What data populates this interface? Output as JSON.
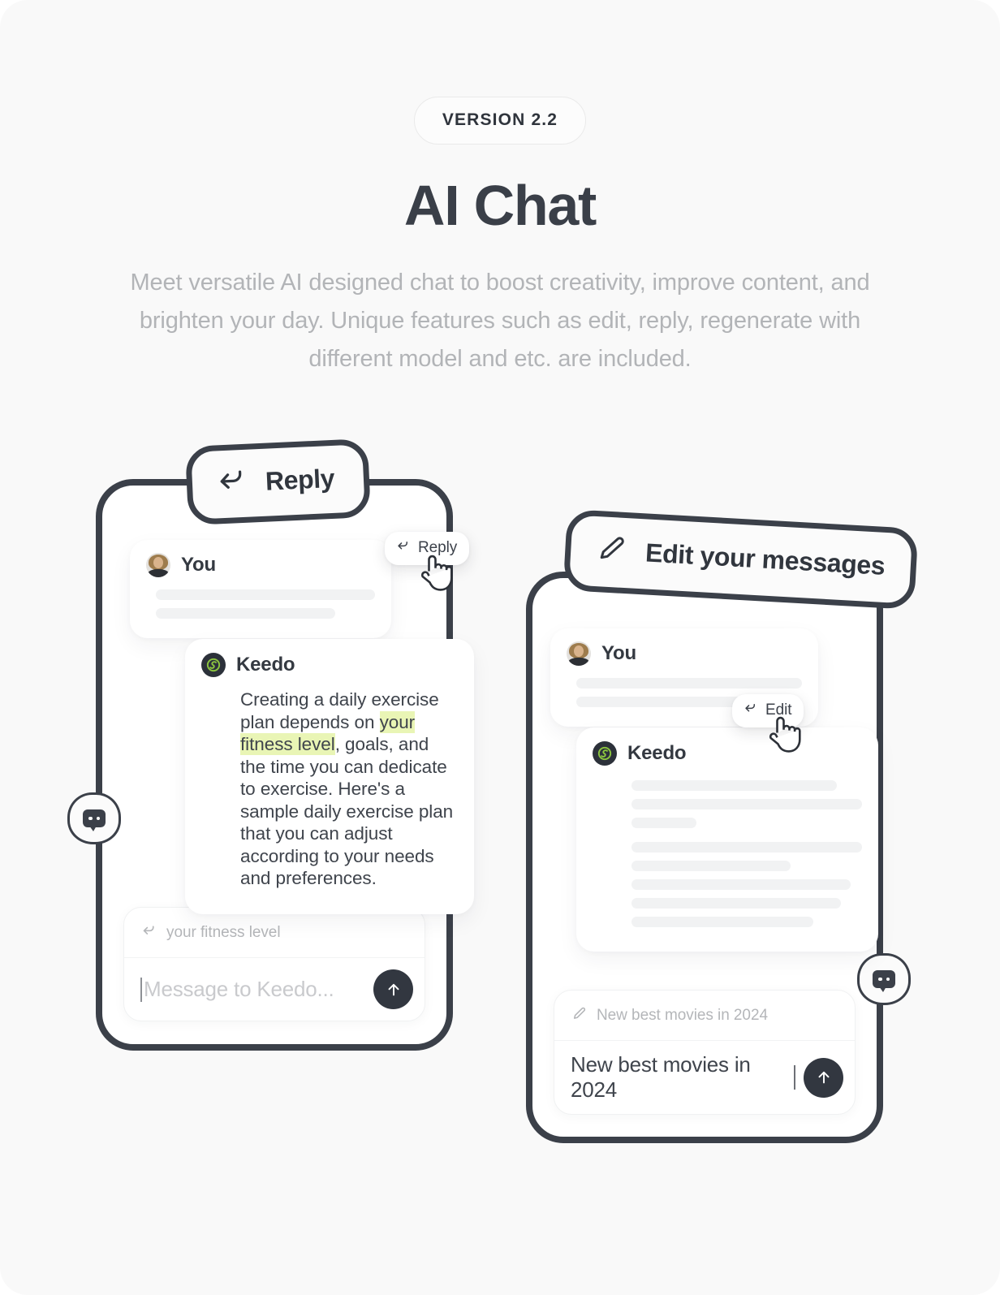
{
  "header": {
    "version_badge": "VERSION 2.2",
    "title": "AI Chat",
    "subtitle": "Meet versatile AI designed chat to boost creativity, improve content, and brighten your day. Unique features such as edit, reply, regenerate with different model and etc. are included."
  },
  "colors": {
    "page_background": "#f9f9f9",
    "frame_dark": "#3b4049",
    "text_dark": "#343941",
    "text_muted": "#b2b4b7",
    "highlight_green": "#e9f5b5",
    "brand_green": "#8cc63f",
    "skeleton_gray": "#f1f2f3"
  },
  "phone_left": {
    "callout": {
      "label": "Reply",
      "icon": "reply-arrow-icon"
    },
    "side_button_icon": "chat-bubble-icon",
    "messages": [
      {
        "author": "You",
        "avatar": "user-photo-avatar",
        "skeleton_widths": [
          "100%",
          "82%"
        ]
      },
      {
        "author": "Keedo",
        "avatar": "keedo-logo-icon",
        "text_before_highlight": "Creating a daily exercise plan depends on ",
        "highlight": "your fitness level",
        "text_after_highlight": ", goals, and the time you can dedicate to exercise. Here's a sample daily exercise plan that you can adjust according to your needs and preferences."
      }
    ],
    "hover_chip": {
      "label": "Reply",
      "icon": "reply-arrow-icon",
      "cursor": "pointer-hand-cursor"
    },
    "composer": {
      "quote_icon": "reply-arrow-icon",
      "quote_text": "your fitness level",
      "input_value": "",
      "input_placeholder": "Message to Keedo...",
      "send_icon": "arrow-up-icon"
    }
  },
  "phone_right": {
    "callout": {
      "label": "Edit your messages",
      "icon": "pencil-icon"
    },
    "side_button_icon": "chat-bubble-icon",
    "messages": [
      {
        "author": "You",
        "avatar": "user-photo-avatar",
        "skeleton_widths": [
          "100%",
          "77%"
        ]
      },
      {
        "author": "Keedo",
        "avatar": "keedo-logo-icon",
        "skeleton_widths": [
          "89%",
          "100%",
          "28%",
          "100%",
          "69%",
          "95%",
          "91%",
          "79%"
        ]
      }
    ],
    "hover_chip": {
      "label": "Edit",
      "icon": "reply-arrow-icon",
      "cursor": "pointer-hand-cursor"
    },
    "composer": {
      "quote_icon": "pencil-icon",
      "quote_text": "New best movies in 2024",
      "input_value": "New best movies in 2024",
      "input_placeholder": "",
      "send_icon": "arrow-up-icon"
    }
  }
}
